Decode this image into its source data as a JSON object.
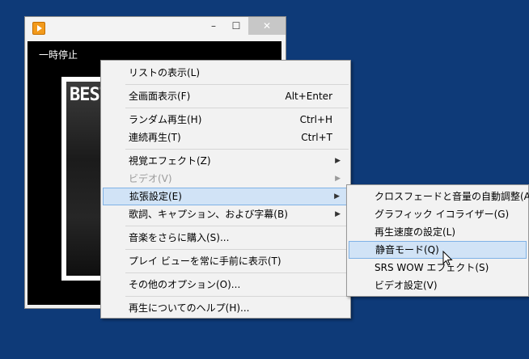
{
  "player": {
    "status": "一時停止",
    "album_title": "BEST",
    "controls": {
      "minimize": "–",
      "maximize": "☐",
      "close": "✕"
    }
  },
  "context_menu": {
    "items": [
      {
        "label": "リストの表示(L)"
      },
      {
        "label": "全画面表示(F)",
        "shortcut": "Alt+Enter"
      },
      {
        "label": "ランダム再生(H)",
        "shortcut": "Ctrl+H"
      },
      {
        "label": "連続再生(T)",
        "shortcut": "Ctrl+T"
      },
      {
        "label": "視覚エフェクト(Z)",
        "arrow": "▶"
      },
      {
        "label": "ビデオ(V)",
        "arrow": "▶",
        "disabled": true
      },
      {
        "label": "拡張設定(E)",
        "arrow": "▶",
        "highlighted": true
      },
      {
        "label": "歌詞、キャプション、および字幕(B)",
        "arrow": "▶"
      },
      {
        "label": "音楽をさらに購入(S)..."
      },
      {
        "label": "プレイ ビューを常に手前に表示(T)"
      },
      {
        "label": "その他のオプション(O)..."
      },
      {
        "label": "再生についてのヘルプ(H)..."
      }
    ]
  },
  "submenu": {
    "items": [
      {
        "label": "クロスフェードと音量の自動調整(A)"
      },
      {
        "label": "グラフィック イコライザー(G)"
      },
      {
        "label": "再生速度の設定(L)"
      },
      {
        "label": "静音モード(Q)",
        "highlighted": true
      },
      {
        "label": "SRS WOW エフェクト(S)"
      },
      {
        "label": "ビデオ設定(V)"
      }
    ]
  },
  "colors": {
    "desktop": "#0e3a78",
    "highlight": "#d1e3f6",
    "highlight_border": "#7fb2e6",
    "menu_bg": "#f2f2f2"
  }
}
